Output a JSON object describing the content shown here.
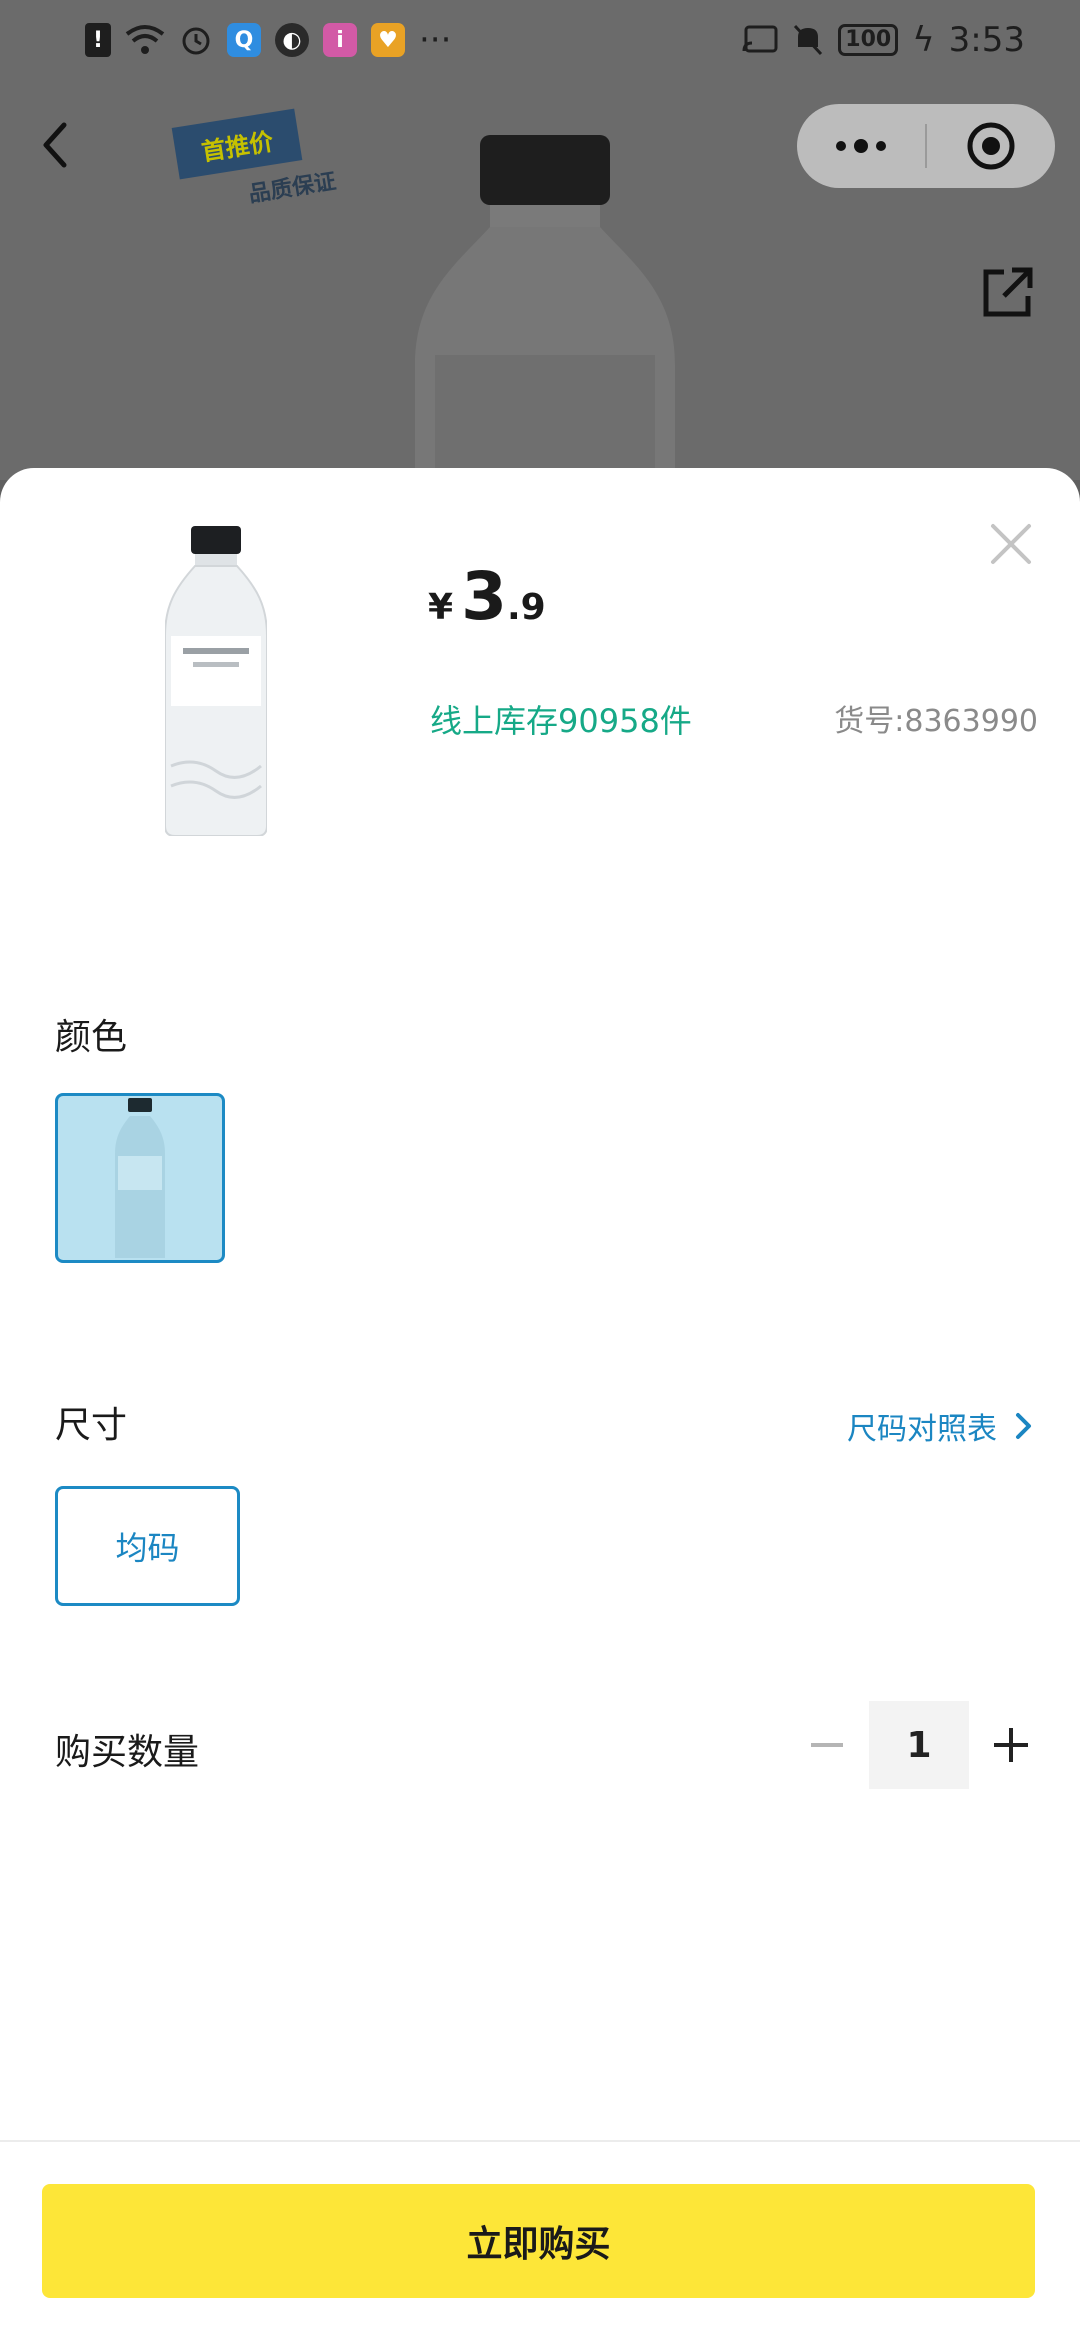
{
  "status_bar": {
    "time": "3:53",
    "battery": "100",
    "more": "···"
  },
  "background_page": {
    "promo_tag": "首推价",
    "promo_sub": "品质保证"
  },
  "product": {
    "currency": "¥",
    "price_integer": "3",
    "price_decimal": ".9",
    "stock": "线上库存90958件",
    "sku": "货号:8363990"
  },
  "color_section": {
    "title": "颜色"
  },
  "size_section": {
    "title": "尺寸",
    "size_chart_link": "尺码对照表",
    "selected_option": "均码"
  },
  "quantity_section": {
    "title": "购买数量",
    "value": "1"
  },
  "buy_button": "立即购买",
  "colors": {
    "accent": "#1c8ac4",
    "stock_green": "#16a987",
    "buy_yellow": "#fde638",
    "swatch_bg": "#b9e1f0"
  }
}
